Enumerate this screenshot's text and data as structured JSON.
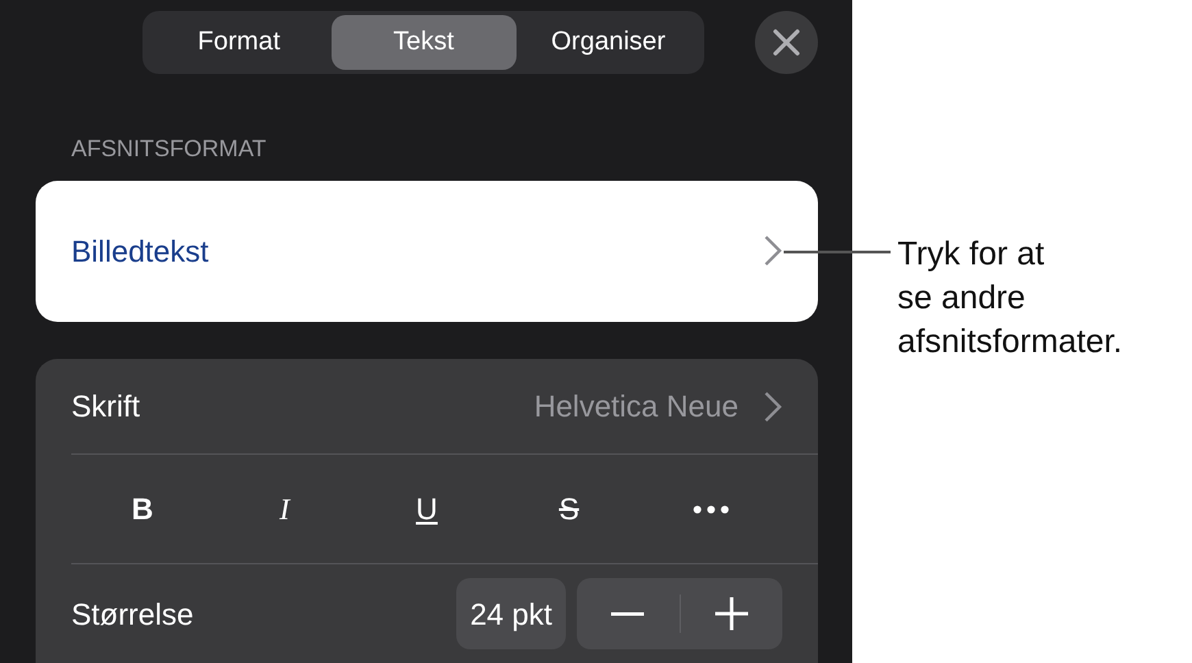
{
  "tabs": [
    {
      "label": "Format",
      "selected": false
    },
    {
      "label": "Tekst",
      "selected": true
    },
    {
      "label": "Organiser",
      "selected": false
    }
  ],
  "section_header": "AFSNITSFORMAT",
  "paragraph_style": {
    "value": "Billedtekst"
  },
  "font_row": {
    "label": "Skrift",
    "value": "Helvetica Neue"
  },
  "style_buttons": [
    {
      "kind": "bold",
      "label": "B"
    },
    {
      "kind": "italic",
      "label": "I"
    },
    {
      "kind": "underline",
      "label": "U"
    },
    {
      "kind": "strike",
      "label": "S"
    },
    {
      "kind": "more"
    }
  ],
  "size_row": {
    "label": "Størrelse",
    "value": "24 pkt"
  },
  "callout": {
    "lines": [
      "Tryk for at",
      "se andre",
      "afsnitsformater."
    ]
  }
}
